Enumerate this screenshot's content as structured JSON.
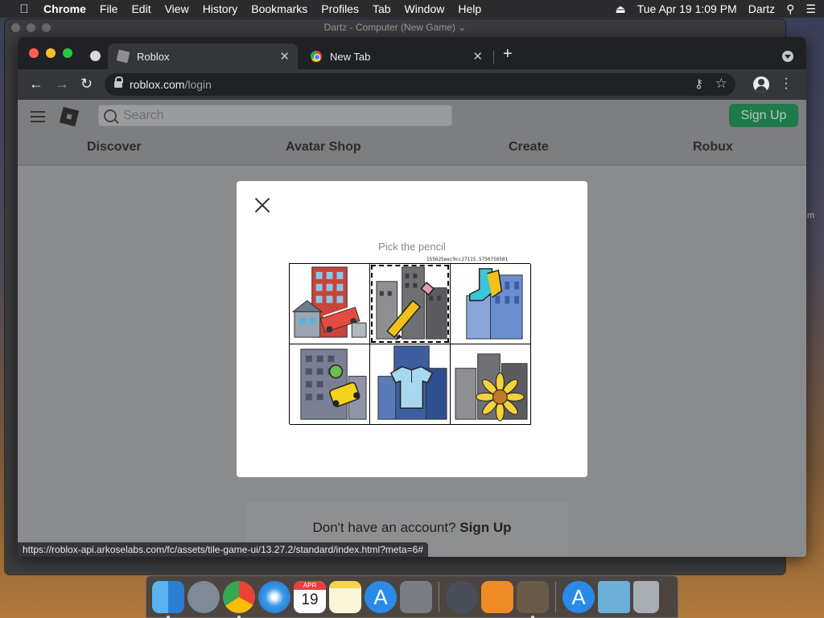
{
  "menubar": {
    "app": "Chrome",
    "items": [
      "File",
      "Edit",
      "View",
      "History",
      "Bookmarks",
      "Profiles",
      "Tab",
      "Window",
      "Help"
    ],
    "datetime": "Tue Apr 19  1:09 PM",
    "user": "Dartz"
  },
  "background_window": {
    "title": "Dartz - Computer   (New Game) ⌄"
  },
  "tabs": [
    {
      "label": "Roblox",
      "active": true
    },
    {
      "label": "New Tab",
      "active": false
    }
  ],
  "address": {
    "domain": "roblox.com",
    "path": "/login"
  },
  "roblox": {
    "search_placeholder": "Search",
    "signup_label": "Sign Up",
    "nav": [
      "Discover",
      "Avatar Shop",
      "Create",
      "Robux"
    ],
    "no_account_text": "Don't have an account?",
    "no_account_link": "Sign Up"
  },
  "captcha": {
    "prompt": "Pick the pencil",
    "game_id": "155625eec9cc27115.5750756501",
    "tiles": [
      {
        "name": "fire-truck",
        "selected": false
      },
      {
        "name": "pencil",
        "selected": true
      },
      {
        "name": "socks",
        "selected": false
      },
      {
        "name": "taxi",
        "selected": false
      },
      {
        "name": "shirt",
        "selected": false
      },
      {
        "name": "sunflower",
        "selected": false
      }
    ]
  },
  "status_url": "https://roblox-api.arkoselabs.com/fc/assets/tile-game-ui/13.27.2/standard/index.html?meta=6#",
  "dock": {
    "calendar_month": "APR",
    "calendar_day": "19",
    "apps": [
      "finder",
      "launchpad",
      "chrome",
      "safari",
      "calendar",
      "notes",
      "app-store",
      "system-preferences",
      "automator",
      "books",
      "chess",
      "app-store-2",
      "downloads-folder",
      "trash"
    ]
  },
  "colors": {
    "signup_green": "#1f7a4a",
    "tab_bg": "#35363a",
    "tabstrip_bg": "#202124"
  }
}
